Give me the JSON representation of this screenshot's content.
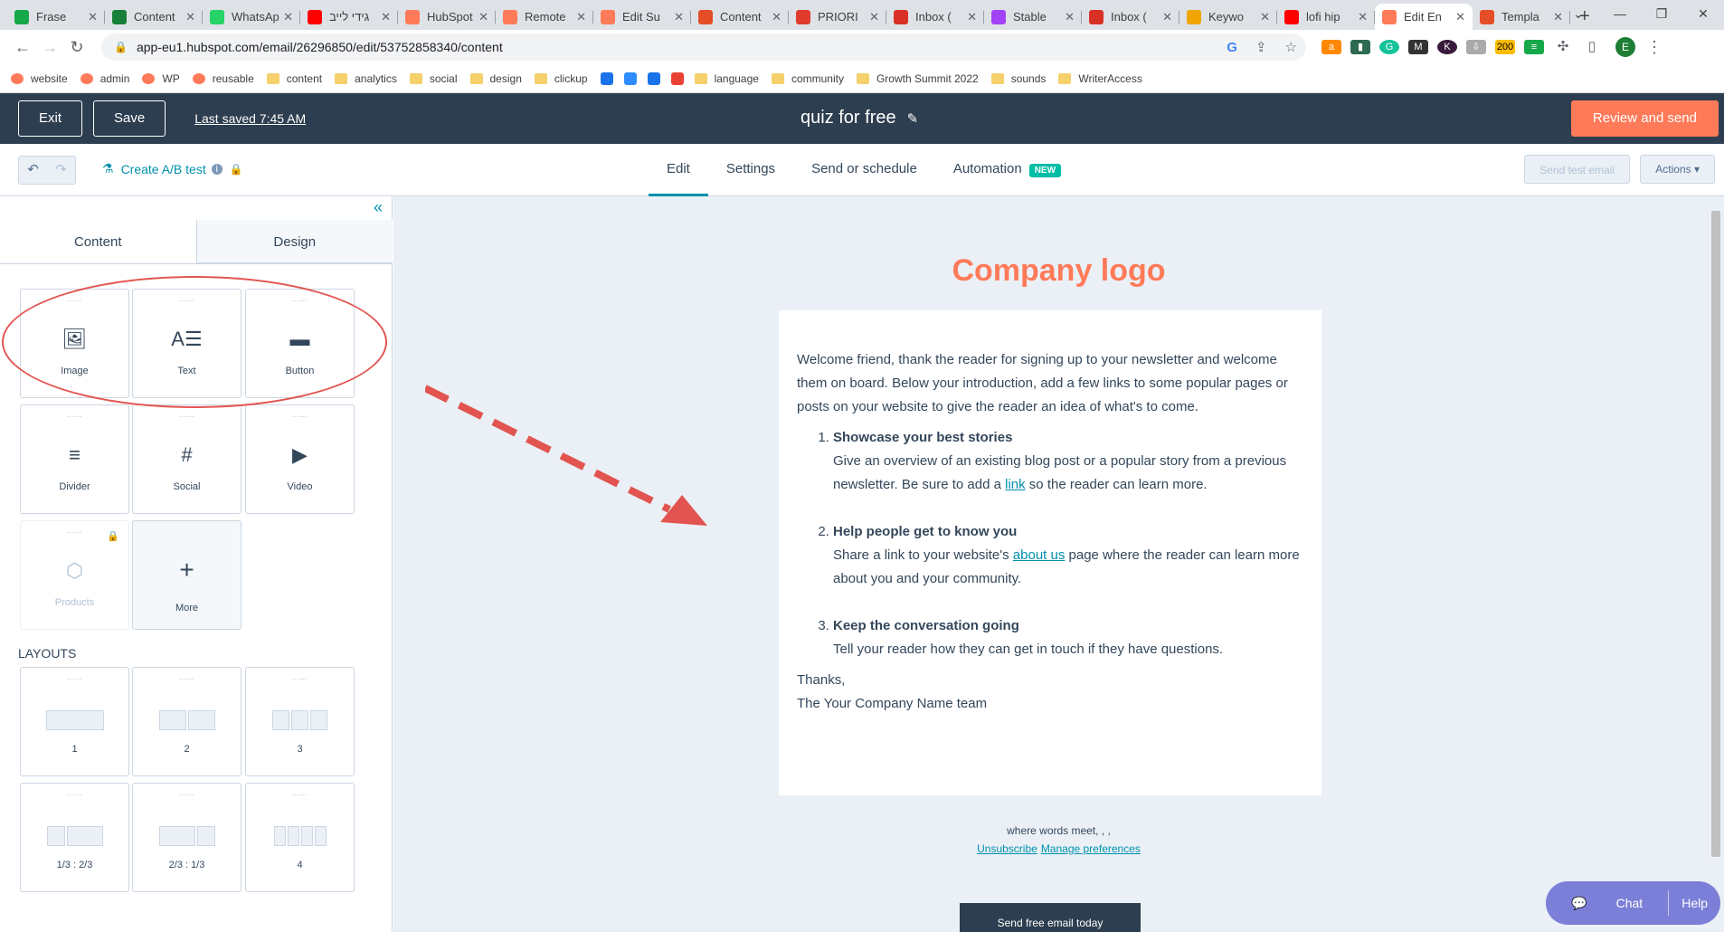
{
  "browser": {
    "tabs": [
      {
        "label": "Frase",
        "color": "#17a84a"
      },
      {
        "label": "Content",
        "color": "#188038"
      },
      {
        "label": "WhatsApp",
        "color": "#25d366"
      },
      {
        "label": "גידי לייב",
        "color": "#ff0000"
      },
      {
        "label": "HubSpot",
        "color": "#ff7a59"
      },
      {
        "label": "Remote",
        "color": "#ff7a59"
      },
      {
        "label": "Edit Su",
        "color": "#ff7a59"
      },
      {
        "label": "Content",
        "color": "#e44d26"
      },
      {
        "label": "PRIORI",
        "color": "#e03c2e"
      },
      {
        "label": "Inbox (",
        "color": "#d93025"
      },
      {
        "label": "Stable",
        "color": "#a142f4"
      },
      {
        "label": "Inbox (",
        "color": "#d93025"
      },
      {
        "label": "Keywo",
        "color": "#f0a500"
      },
      {
        "label": "lofi hip",
        "color": "#ff0000"
      },
      {
        "label": "Edit En",
        "color": "#ff7a59",
        "active": true
      },
      {
        "label": "Templa",
        "color": "#e44d26"
      }
    ],
    "url": "app-eu1.hubspot.com/email/26296850/edit/53752858340/content",
    "profile_initial": "E",
    "bookmarks": [
      "website",
      "admin",
      "WP",
      "reusable",
      "content",
      "analytics",
      "social",
      "design",
      "clickup",
      "language",
      "community",
      "Growth Summit 2022",
      "sounds",
      "WriterAccess"
    ]
  },
  "header": {
    "exit_label": "Exit",
    "save_label": "Save",
    "last_saved": "Last saved 7:45 AM",
    "email_name": "quiz for free",
    "review_label": "Review and send"
  },
  "toolbar": {
    "ab_test_label": "Create A/B test",
    "tabs": [
      "Edit",
      "Settings",
      "Send or schedule",
      "Automation"
    ],
    "new_badge": "NEW",
    "send_test_label": "Send test email",
    "actions_label": "Actions ▾"
  },
  "panel": {
    "tab_content": "Content",
    "tab_design": "Design",
    "modules": [
      "Image",
      "Text",
      "Button",
      "Divider",
      "Social",
      "Video",
      "Products",
      "More"
    ],
    "layouts_heading": "LAYOUTS",
    "layouts": [
      "1",
      "2",
      "3",
      "1/3 : 2/3",
      "2/3 : 1/3",
      "4"
    ]
  },
  "email": {
    "logo_text": "Company logo",
    "intro": "Welcome friend, thank the reader for signing up to your newsletter and welcome them on board. Below your introduction, add a few links to some popular pages or posts on your website to give the reader an idea of what's to come.",
    "items": [
      {
        "title": "Showcase your best stories",
        "text_before": "Give an overview of an existing blog post or a popular story from a previous newsletter. Be sure to add a ",
        "link": "link",
        "text_after": " so the reader can learn more."
      },
      {
        "title": "Help people get to know you",
        "text_before": "Share a link to your website's ",
        "link": "about us",
        "text_after": " page where the reader can learn more about you and your community."
      },
      {
        "title": "Keep the conversation going",
        "text_before": "Tell your reader how they can get in touch if they have questions.",
        "link": "",
        "text_after": ""
      }
    ],
    "sign_off": "Thanks,",
    "team": "The Your Company Name team",
    "footer_text": "where words meet, , ,",
    "unsubscribe": "Unsubscribe",
    "manage_prefs": "Manage preferences",
    "cta_label": "Send free email today"
  },
  "chat": {
    "chat_label": "Chat",
    "help_label": "Help"
  },
  "colors": {
    "accent": "#ff7a59",
    "header_bg": "#2d3e50",
    "link": "#0091ae",
    "annotation": "#e2544f"
  }
}
